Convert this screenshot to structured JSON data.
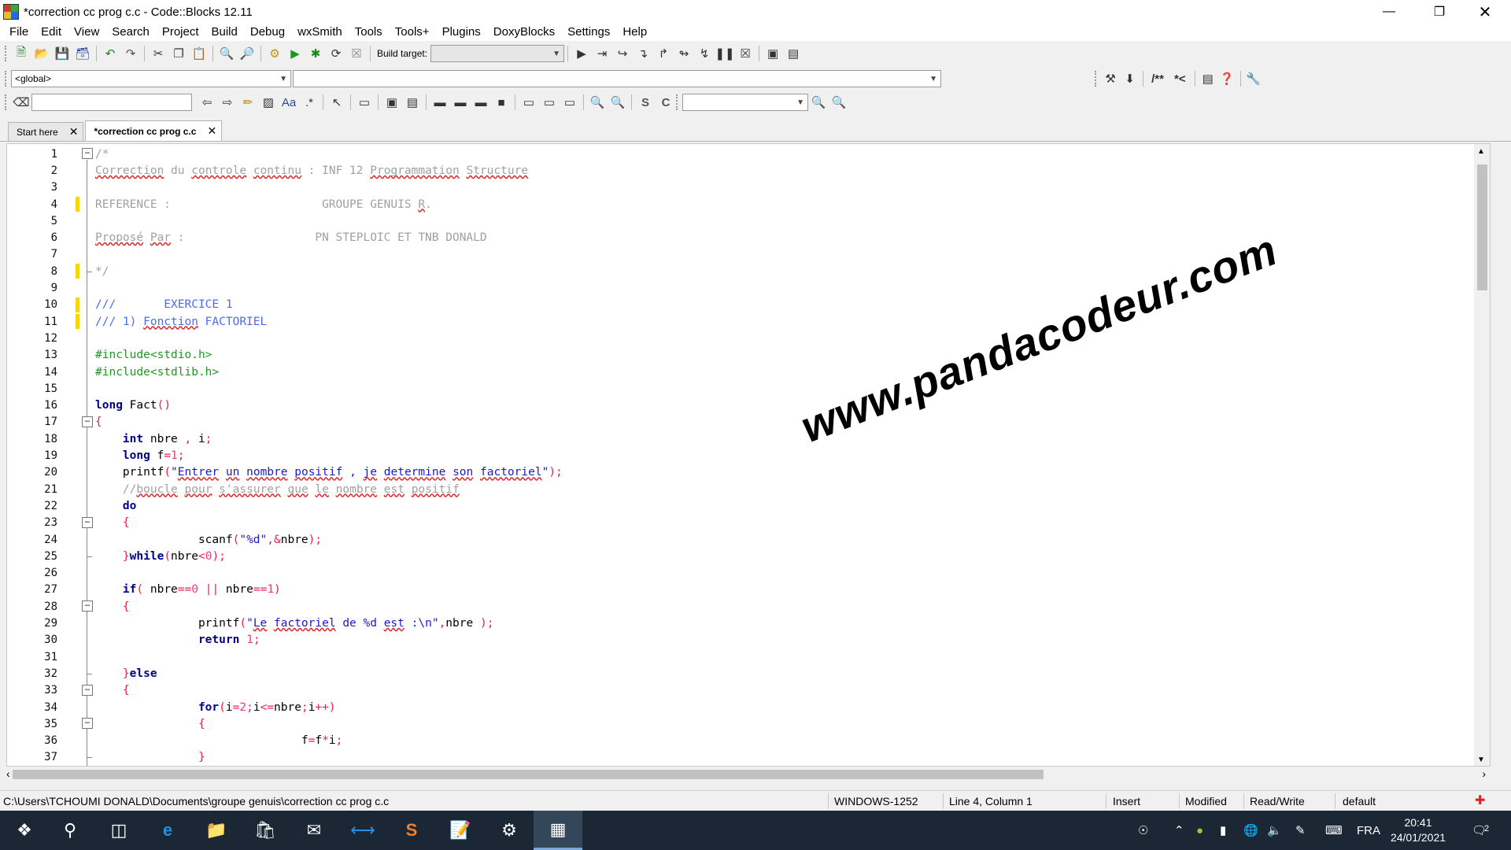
{
  "window": {
    "title": "*correction cc prog c.c - Code::Blocks 12.11",
    "minimize_icon": "minimize-icon",
    "maximize_icon": "restore-icon",
    "close_icon": "close-icon"
  },
  "menu": [
    "File",
    "Edit",
    "View",
    "Search",
    "Project",
    "Build",
    "Debug",
    "wxSmith",
    "Tools",
    "Tools+",
    "Plugins",
    "DoxyBlocks",
    "Settings",
    "Help"
  ],
  "toolbar": {
    "build_target_label": "Build target:",
    "build_target_value": ""
  },
  "code_completion": {
    "scope": "<global>",
    "function": ""
  },
  "doxyblocks": {
    "block_comment": "/**",
    "line_comment": "*<"
  },
  "search": {
    "find_value": "",
    "find_combo_value": ""
  },
  "tabs": [
    {
      "label": "Start here",
      "active": false
    },
    {
      "label": "*correction cc prog c.c",
      "active": true
    }
  ],
  "editor": {
    "lines": [
      {
        "n": "1",
        "text": "/*"
      },
      {
        "n": "2",
        "text": "Correction du controle continu : INF 12 Programmation Structure"
      },
      {
        "n": "3",
        "text": ""
      },
      {
        "n": "4",
        "text": "REFERENCE :                      GROUPE GENUIS R."
      },
      {
        "n": "5",
        "text": ""
      },
      {
        "n": "6",
        "text": "Proposé Par :                   PN STEPLOIC ET TNB DONALD"
      },
      {
        "n": "7",
        "text": ""
      },
      {
        "n": "8",
        "text": "*/"
      },
      {
        "n": "9",
        "text": ""
      },
      {
        "n": "10",
        "text": "///       EXERCICE 1"
      },
      {
        "n": "11",
        "text": "/// 1) Fonction FACTORIEL"
      },
      {
        "n": "12",
        "text": ""
      },
      {
        "n": "13",
        "text": "#include<stdio.h>"
      },
      {
        "n": "14",
        "text": "#include<stdlib.h>"
      },
      {
        "n": "15",
        "text": ""
      },
      {
        "n": "16",
        "text": "long Fact()"
      },
      {
        "n": "17",
        "text": "{"
      },
      {
        "n": "18",
        "text": "    int nbre , i;"
      },
      {
        "n": "19",
        "text": "    long f=1;"
      },
      {
        "n": "20",
        "text": "    printf(\"Entrer un nombre positif , je determine son factoriel\");"
      },
      {
        "n": "21",
        "text": "    //boucle pour s'assurer que le nombre est positif"
      },
      {
        "n": "22",
        "text": "    do"
      },
      {
        "n": "23",
        "text": "    {"
      },
      {
        "n": "24",
        "text": "               scanf(\"%d\",&nbre);"
      },
      {
        "n": "25",
        "text": "    }while(nbre<0);"
      },
      {
        "n": "26",
        "text": ""
      },
      {
        "n": "27",
        "text": "    if( nbre==0 || nbre==1)"
      },
      {
        "n": "28",
        "text": "    {"
      },
      {
        "n": "29",
        "text": "               printf(\"Le factoriel de %d est :\\n\",nbre );"
      },
      {
        "n": "30",
        "text": "               return 1;"
      },
      {
        "n": "31",
        "text": ""
      },
      {
        "n": "32",
        "text": "    }else"
      },
      {
        "n": "33",
        "text": "    {"
      },
      {
        "n": "34",
        "text": "               for(i=2;i<=nbre;i++)"
      },
      {
        "n": "35",
        "text": "               {"
      },
      {
        "n": "36",
        "text": "                              f=f*i;"
      },
      {
        "n": "37",
        "text": "               }"
      }
    ]
  },
  "watermark": "www.pandacodeur.com",
  "status": {
    "path": "C:\\Users\\TCHOUMI DONALD\\Documents\\groupe genuis\\correction cc prog c.c",
    "encoding": "WINDOWS-1252",
    "position": "Line 4, Column 1",
    "mode": "Insert",
    "modified": "Modified",
    "access": "Read/Write",
    "profile": "default"
  },
  "taskbar": {
    "language": "FRA",
    "time": "20:41",
    "date": "24/01/2021",
    "notifications": "2"
  }
}
